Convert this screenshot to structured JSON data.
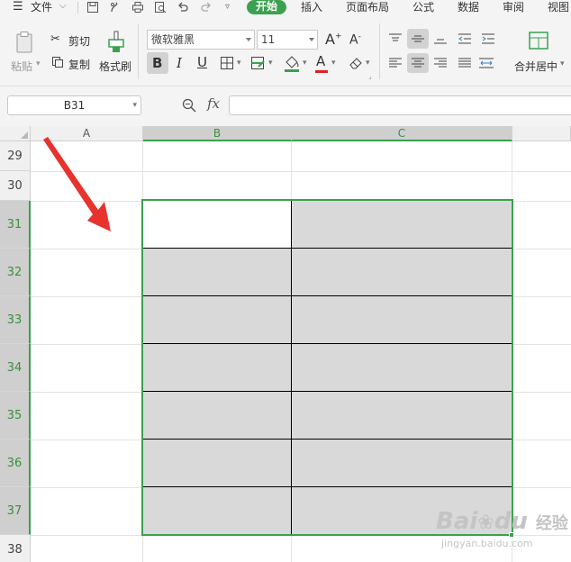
{
  "menu": {
    "file_label": "文件",
    "tabs": [
      "开始",
      "插入",
      "页面布局",
      "公式",
      "数据",
      "审阅",
      "视图"
    ],
    "active_tab": "开始"
  },
  "ribbon": {
    "paste_label": "粘贴",
    "cut_label": "剪切",
    "copy_label": "复制",
    "format_painter_label": "格式刷",
    "font_name": "微软雅黑",
    "font_size": "11",
    "font_increase": "A",
    "font_decrease": "A",
    "bold": "B",
    "italic": "I",
    "underline": "U",
    "font_color_glyph": "A",
    "merge_center_label": "合并居中",
    "accent_color": "#3aa14f",
    "font_color_bar": "#e02020"
  },
  "formula_bar": {
    "name_box": "B31",
    "fx_label": "fx",
    "formula_value": ""
  },
  "sheet": {
    "columns": [
      "A",
      "B",
      "C"
    ],
    "rows": [
      "29",
      "30",
      "31",
      "32",
      "33",
      "34",
      "35",
      "36",
      "37",
      "38"
    ],
    "selected_columns": [
      "B",
      "C"
    ],
    "selected_rows": [
      "31",
      "32",
      "33",
      "34",
      "35",
      "36",
      "37"
    ],
    "active_cell": "B31",
    "selection_fill": "#d9d9d9",
    "selection_border": "#3aa14f",
    "arrow_color": "#e8322d"
  },
  "watermark": {
    "brand": "Bai",
    "paw": "du",
    "cn": "经验",
    "url": "jingyan.baidu.com"
  }
}
